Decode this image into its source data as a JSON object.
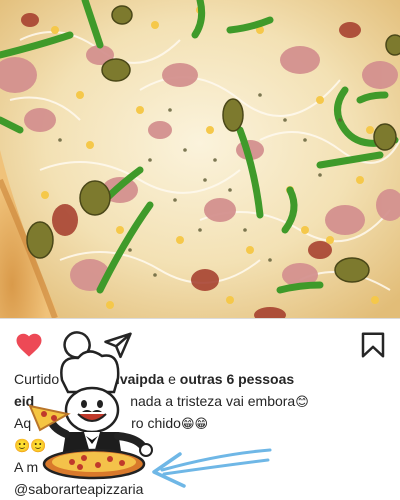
{
  "post": {
    "photo_alt": "pizza",
    "actions": {
      "like_icon": "heart-icon",
      "comment_icon": "speech-bubble-icon",
      "share_icon": "paper-plane-icon",
      "save_icon": "bookmark-icon",
      "like_color": "#ed4956"
    },
    "likes": {
      "prefix": "Curtido por ",
      "user": "dosilvaipda",
      "joiner": " e ",
      "others": "outras 6 pessoas"
    },
    "caption": {
      "line1_user_fragment": "eid",
      "line1_text": "nada a tristeza vai embora",
      "line1_emoji": "😊",
      "line2_start": "Aq",
      "line2_text": "ro chido",
      "line2_emoji": "😁😁",
      "line3_emoji": "🙂🙂",
      "line4_text": "A m",
      "handle": "@saborarteapizzaria"
    }
  }
}
